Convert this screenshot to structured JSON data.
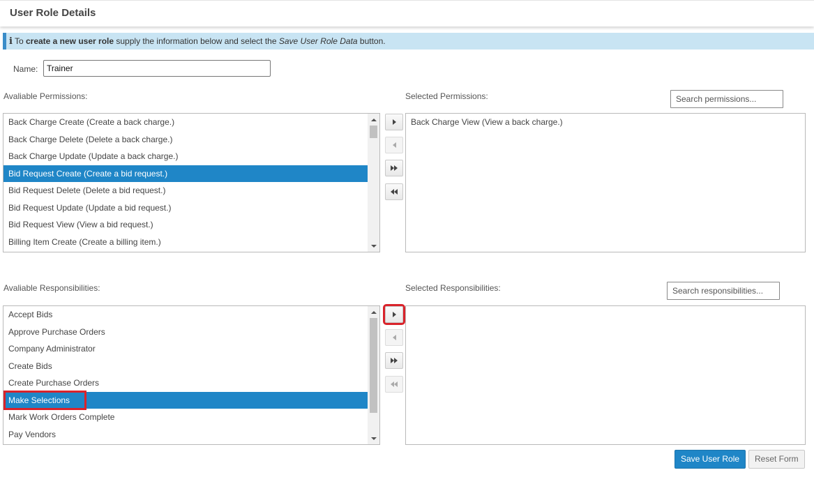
{
  "header": {
    "title": "User Role Details"
  },
  "info": {
    "icon": "info-icon",
    "prefix": "To ",
    "bold": "create a new user role",
    "middle": " supply the information below and select the ",
    "italic": "Save User Role Data",
    "suffix": " button."
  },
  "name": {
    "label": "Name:",
    "value": "Trainer"
  },
  "permissions": {
    "available_label": "Avaliable Permissions:",
    "selected_label": "Selected Permissions:",
    "search_placeholder": "Search permissions...",
    "available": [
      "Back Charge Create (Create a back charge.)",
      "Back Charge Delete (Delete a back charge.)",
      "Back Charge Update (Update a back charge.)",
      "Bid Request Create (Create a bid request.)",
      "Bid Request Delete (Delete a bid request.)",
      "Bid Request Update (Update a bid request.)",
      "Bid Request View (View a bid request.)",
      "Billing Item Create (Create a billing item.)"
    ],
    "available_selected_index": 3,
    "selected": [
      "Back Charge View (View a back charge.)"
    ]
  },
  "responsibilities": {
    "available_label": "Avaliable Responsibilities:",
    "selected_label": "Selected Responsibilities:",
    "search_placeholder": "Search responsibilities...",
    "available": [
      "Accept Bids",
      "Approve Purchase Orders",
      "Company Administrator",
      "Create Bids",
      "Create Purchase Orders",
      "Make Selections",
      "Mark Work Orders Complete",
      "Pay Vendors"
    ],
    "available_selected_index": 5,
    "selected": []
  },
  "move_buttons": {
    "move_right_icon": "chevron-right-icon",
    "move_left_icon": "chevron-left-icon",
    "move_all_right_icon": "double-chevron-right-icon",
    "move_all_left_icon": "double-chevron-left-icon"
  },
  "actions": {
    "save_label": "Save User Role",
    "reset_label": "Reset Form"
  },
  "colors": {
    "accent": "#1f86c7",
    "info_background": "#c8e4f3",
    "annotation_red": "#d9232b"
  }
}
